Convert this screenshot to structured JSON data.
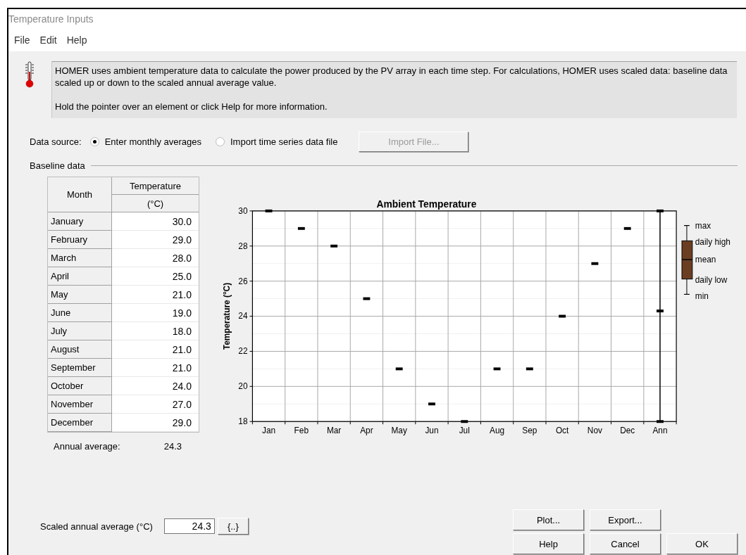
{
  "window": {
    "title": "Temperature Inputs"
  },
  "menu": [
    {
      "label": "File"
    },
    {
      "label": "Edit"
    },
    {
      "label": "Help"
    }
  ],
  "info": {
    "paragraphs": [
      "HOMER uses ambient temperature data to calculate the power produced by the PV array in each time step. For calculations, HOMER uses scaled data: baseline data scaled up or down to the scaled annual average value.",
      "Hold the pointer over an element or click Help for more information."
    ]
  },
  "data_source": {
    "label": "Data source:",
    "options": [
      {
        "label": "Enter monthly averages",
        "selected": true
      },
      {
        "label": "Import time series data file",
        "selected": false
      }
    ],
    "button": {
      "label": "Import File...",
      "disabled": true
    }
  },
  "baseline": {
    "title": "Baseline data",
    "table": {
      "columns": [
        "Month",
        "Temperature",
        "(°C)"
      ],
      "rows": [
        {
          "month": "January",
          "value": "30.0"
        },
        {
          "month": "February",
          "value": "29.0"
        },
        {
          "month": "March",
          "value": "28.0"
        },
        {
          "month": "April",
          "value": "25.0"
        },
        {
          "month": "May",
          "value": "21.0"
        },
        {
          "month": "June",
          "value": "19.0"
        },
        {
          "month": "July",
          "value": "18.0"
        },
        {
          "month": "August",
          "value": "21.0"
        },
        {
          "month": "September",
          "value": "21.0"
        },
        {
          "month": "October",
          "value": "24.0"
        },
        {
          "month": "November",
          "value": "27.0"
        },
        {
          "month": "December",
          "value": "29.0"
        }
      ]
    },
    "annual_average": {
      "label": "Annual average:",
      "value": "24.3"
    },
    "chart_data": {
      "type": "scatter",
      "title": "Ambient Temperature",
      "ylabel": "Temperature (°C)",
      "categories": [
        "Jan",
        "Feb",
        "Mar",
        "Apr",
        "May",
        "Jun",
        "Jul",
        "Aug",
        "Sep",
        "Oct",
        "Nov",
        "Dec",
        "Ann"
      ],
      "series": [
        {
          "name": "mean",
          "color": "#000000",
          "values": [
            30,
            29,
            28,
            25,
            21,
            19,
            18,
            21,
            21,
            24,
            27,
            29,
            24.3
          ]
        },
        {
          "name": "max",
          "color": "#000000",
          "values": [
            null,
            null,
            null,
            null,
            null,
            null,
            null,
            null,
            null,
            null,
            null,
            null,
            30
          ]
        },
        {
          "name": "min",
          "color": "#000000",
          "values": [
            null,
            null,
            null,
            null,
            null,
            null,
            null,
            null,
            null,
            null,
            null,
            null,
            18
          ]
        }
      ],
      "ylim": [
        18,
        30
      ],
      "yticks": [
        18,
        20,
        22,
        24,
        26,
        28,
        30
      ],
      "grid": true,
      "legend": "right"
    },
    "legend": [
      "daily high",
      "daily low"
    ]
  },
  "scaled": {
    "label": "Scaled annual average (°C)",
    "value": "24.3",
    "button": "{..}"
  },
  "buttons": [
    {
      "label": "Plot...",
      "disabled": false
    },
    {
      "label": "Export...",
      "disabled": false
    },
    {
      "label": "Help",
      "disabled": false
    },
    {
      "label": "Cancel",
      "disabled": false
    },
    {
      "label": "OK",
      "disabled": false
    }
  ]
}
